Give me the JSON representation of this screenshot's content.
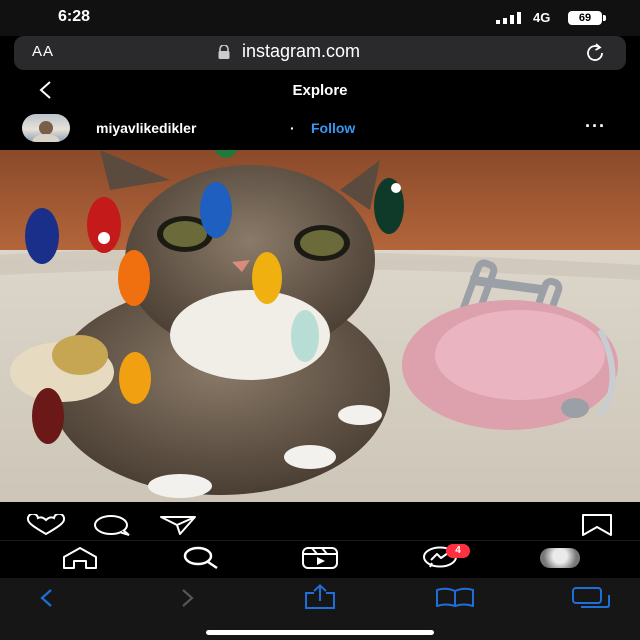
{
  "status": {
    "time": "6:28",
    "network": "4G",
    "battery": "69"
  },
  "browser": {
    "text_size_label": "AA",
    "url": "instagram.com"
  },
  "header": {
    "title": "Explore"
  },
  "post": {
    "username": "miyavlikedikler",
    "separator": "·",
    "follow_label": "Follow",
    "more_label": "···"
  },
  "nav": {
    "notification_count": "4"
  },
  "colors": {
    "accent": "#3897f0",
    "badge": "#ff3040",
    "safari_icon": "#1e6fd9"
  },
  "icons": [
    "signal-icon",
    "lock-icon",
    "reload-icon",
    "back-arrow-icon",
    "heart-icon",
    "comment-icon",
    "share-icon",
    "bookmark-icon",
    "home-icon",
    "search-icon",
    "reels-icon",
    "messenger-icon",
    "safari-back-icon",
    "safari-forward-icon",
    "safari-share-icon",
    "safari-bookmarks-icon",
    "safari-tabs-icon"
  ]
}
